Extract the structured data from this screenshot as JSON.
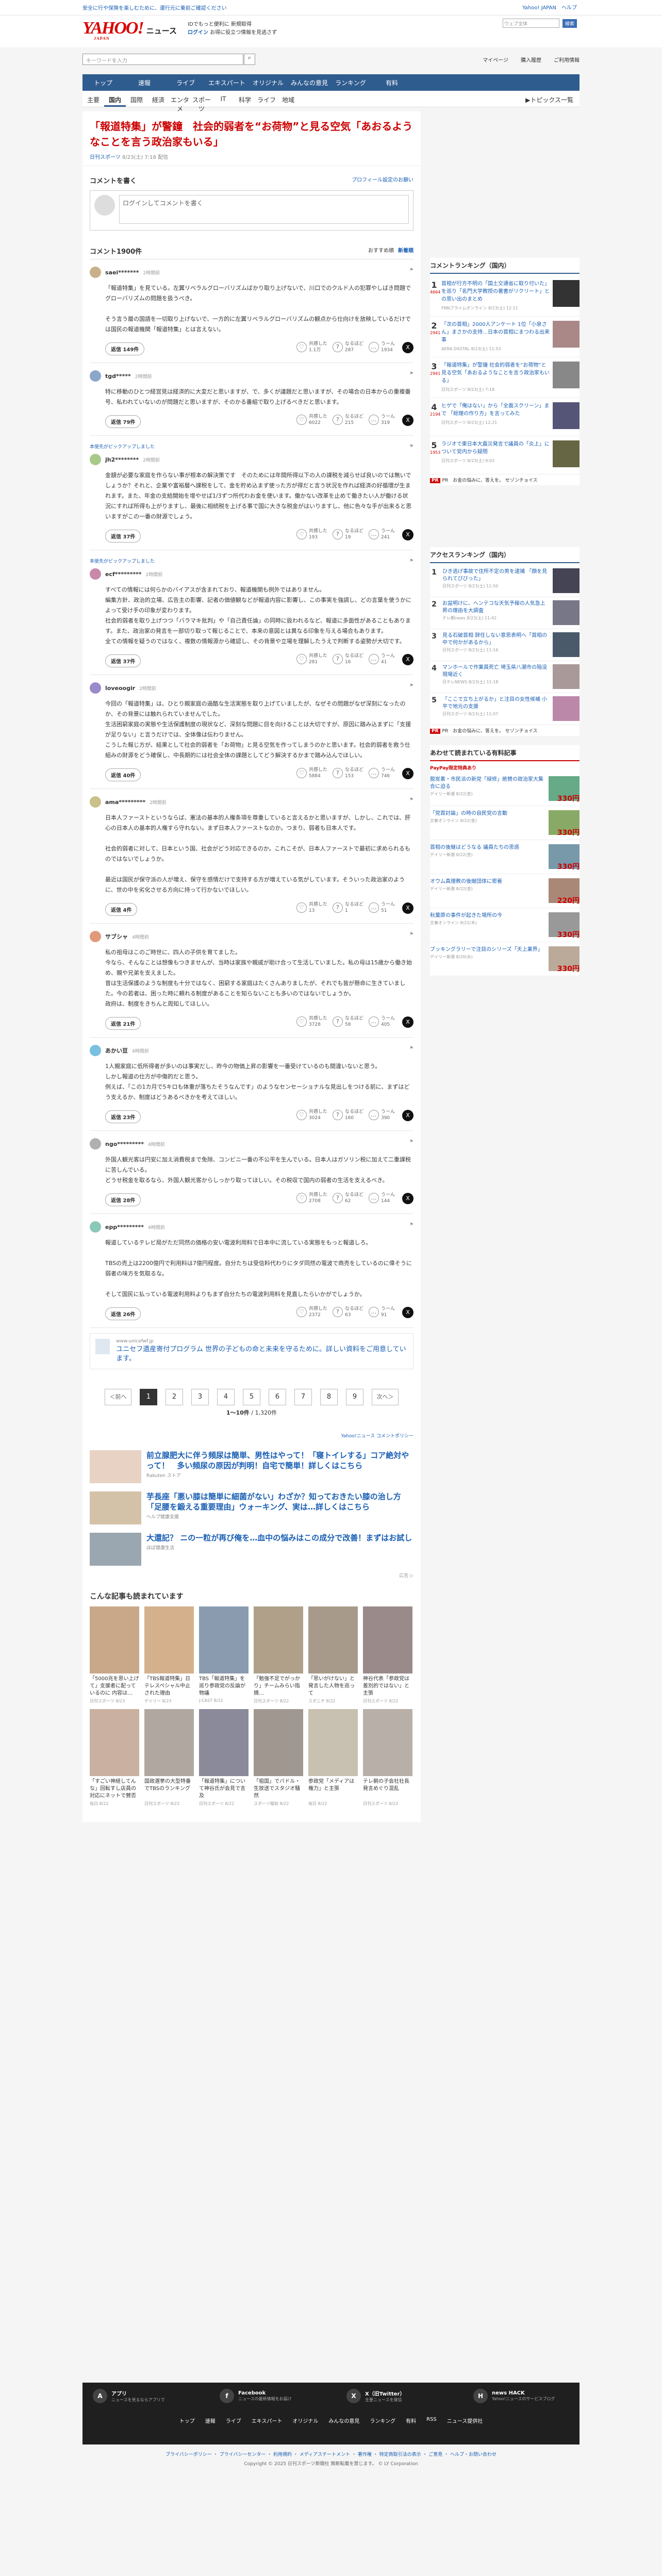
{
  "ticker": {
    "left": "安全に行や保険を楽しむために、運行元に乗前ご確認ください",
    "right": "Yahoo! JAPAN　ヘルプ"
  },
  "header": {
    "logo": "YAHOO!",
    "logo_sub": "ニュース",
    "logo_jp": "JAPAN",
    "line1": "IDでもっと便利に 新規取得",
    "line2_a": "ログイン",
    "line2_b": "お得に役立つ情報を見逃さず",
    "search_ph": "ウェブ全体",
    "search_btn": "検索",
    "search_tab": "▶ 新規取得する"
  },
  "search": {
    "placeholder": "キーワードを入力",
    "links": [
      "マイページ",
      "購入履歴",
      "ご利用情報"
    ]
  },
  "nav1": [
    "トップ",
    "速報",
    "ライブ",
    "エキスパート",
    "オリジナル",
    "みんなの意見",
    "ランキング",
    "有料"
  ],
  "nav2": [
    "主要",
    "国内",
    "国際",
    "経済",
    "エンタメ",
    "スポーツ",
    "IT",
    "科学",
    "ライフ",
    "地域"
  ],
  "nav2_topics": "▶トピックス一覧",
  "article": {
    "title": "「報道特集」が警鐘　社会的弱者を“お荷物”と見る空気「あおるようなことを言う政治家もいる」",
    "source": "日刊スポーツ",
    "time": "8/23(土) 7:18 配信"
  },
  "comment_write": {
    "title": "コメントを書く",
    "profile": "プロフィール設定のお願い",
    "placeholder": "ログインしてコメントを書く"
  },
  "comments_head": {
    "title": "コメント1900件",
    "sort_a": "おすすめ順",
    "sort_b": "新着順"
  },
  "comments": [
    {
      "expert": "",
      "user": "saei*******",
      "time": "2時間前",
      "body": "「報道特集」を見ている。左翼リベラルグローバリズムばかり取り上げないで、川口でのクルド人の犯罪やしばき問題でグローバリズムの問題を扱うべき。\n\nそう言う層の国語を一切取り上げないで、一方的に左翼リベラルグローバリズムの観点から仕向けを放映しているだけでは国民の報道機関「報道特集」とは言えない。",
      "reply": "返信 149件",
      "a": "共感した",
      "ac": "1.1万",
      "b": "なるほど",
      "bc": "287",
      "c": "うーん",
      "cc": "1934"
    },
    {
      "expert": "",
      "user": "tgd*****",
      "time": "2時間前",
      "body": "特に移動のひとつ経営見は経済的に大変だと思いますが、で、多くが議題だと思いますが、その場合の日本からの重複番号、私われていないのが問題だと思いますが、そのかる番組で取り上げるべきだと思います。",
      "reply": "返信 79件",
      "a": "共感した",
      "ac": "6022",
      "b": "なるほど",
      "bc": "215",
      "c": "うーん",
      "cc": "319"
    },
    {
      "expert": "本使先がピックアップしました",
      "user": "jh2********",
      "time": "2時間前",
      "body": "金額が必要な家庭を作らない事が根本の解決策です　そのためには年間所得以下の人の課税を減らせば良いのでは無いでしょうか？それと、企業や富裕層へ課税をして、金を貯め込まず使った方が得だと言う状況を作れば経済の好循環が生まれます。また、年金の支給開始を增やせば1/3ずつ所代わお金を使います。働かない改革を止めて働きたい人が働ける状況にすれば所得も上がりますし、最後に相続税を上げる事で国に大きな税金がはいりますし、他に色々な手が出来ると思いますがこの一番の財源でしょう。",
      "reply": "返信 37件",
      "a": "共感した",
      "ac": "193",
      "b": "なるほど",
      "bc": "19",
      "c": "うーん",
      "cc": "241"
    },
    {
      "expert": "本使先がピックアップしました",
      "user": "ecf*********",
      "time": "2時間前",
      "body": "すべての情報には何らかのバイアスが含まれており、報道機関も例外ではありません。\n編集方針、政治的立場、広告主の影響、記者の価値観などが報道内容に影響し、この事実を強調し、どの言葉を使うかによって受け手の印象が変わります。\n社会的弱者を取り上げつつ「バラマキ批判」や「自己責任論」の同時に扱われるなど、報道に多面性があることもあります。また、政治家の発言を一部切り取って報じることで、本来の意図とは異なる印象を与える場合もあります。\n全ての情報を疑うのではなく、複数の情報源から確認し、その背景や立場を理解したうえで判断する姿勢が大切です。",
      "reply": "返信 37件",
      "a": "共感した",
      "ac": "281",
      "b": "なるほど",
      "bc": "16",
      "c": "うーん",
      "cc": "41"
    },
    {
      "expert": "",
      "user": "loveoogir",
      "time": "2時間前",
      "body": "今回の「報道特集」は、ひとり親家庭の過酷な生活実態を取り上げていましたが、なぜその問題がなぜ深刻になったのか、その背景には触れられていませんでした。\n生活困窮家庭の実態や生活保護制度の現状など、深刻な問題に目を向けることは大切ですが、原因に踏み込まずに「支援が足りない」と言うだけでは、全体像は伝わりません。\nこうした報じ方が、結果として社会的弱者を「お荷物」と見る空気を作ってしまうのかと思います。社会的弱者を救う仕組みの財源をどう確保し、中長期的には社会全体の課題としてどう解決するかまで踏み込んでほしい。",
      "reply": "返信 40件",
      "a": "共感した",
      "ac": "5884",
      "b": "なるほど",
      "bc": "153",
      "c": "うーん",
      "cc": "746"
    },
    {
      "expert": "",
      "user": "ama*********",
      "time": "2時間前",
      "body": "日本人ファーストというならば、憲法の基本的人権条項を尊重していると言えるかと思いますが、しかし、これでは、肝心の日本人の基本的人権すら守れない。まず日本人ファーストなのか。つまり、弱者も日本人です。\n\n社会的弱者に対して、日本という国、社会がどう対応できるのか。これこそが、日本人ファーストで最初に求められるものではないでしょうか。\n\n最近は国民が保守派の人が増え、保守を感情だけで支持する方が増えている気がしています。そういった政治家のように、世の中を劣化させる方向に持って行かないでほしい。",
      "reply": "返信 4件",
      "a": "共感した",
      "ac": "13",
      "b": "なるほど",
      "bc": "1",
      "c": "うーん",
      "cc": "51"
    },
    {
      "expert": "",
      "user": "サブシャ",
      "time": "4時間前",
      "body": "私の祖母はこのご時世に、四人の子供を育てました。\n今なら、そんなことは想像もつきませんが、当時は家族や親戚が助け合って生活していました。私の母は15歳から働き始め、親や兄弟を支えました。\n昔は生活保護のような制度も十分ではなく、困窮する家庭はたくさんありましたが、それでも皆が懸命に生きていました。今の若者は、困った時に頼れる制度があることを知らないことも多いのではないでしょうか。\n政府は、制度をきちんと周知してほしい。",
      "reply": "返信 21件",
      "a": "共感した",
      "ac": "3728",
      "b": "なるほど",
      "bc": "58",
      "c": "うーん",
      "cc": "405"
    },
    {
      "expert": "",
      "user": "あかい豆",
      "time": "4時間前",
      "body": "1人親家庭に低所得者が多いのは事実だし、昨今の物価上昇の影響を一番受けているのも間違いないと思う。\nしかし報道の仕方が中傷的だと思う。\n例えば、「この1カ月で5キロも体重が落ちたそうなんです」のようなセンセーショナルな見出しをつける前に、まずはどう支えるか、制度はどうあるべきかを考えてほしい。",
      "reply": "返信 23件",
      "a": "共感した",
      "ac": "3024",
      "b": "なるほど",
      "bc": "160",
      "c": "うーん",
      "cc": "390"
    },
    {
      "expert": "",
      "user": "ngo*********",
      "time": "4時間前",
      "body": "外国人観光客は円安に加え消費税まで免除、コンビニ一番の不公平を生んでいる。日本人はガソリン税に加えて二重課税に苦しんでいる。\nどうせ税金を取るなら、外国人観光客からしっかり取ってほしい。その税収で国内の弱者の生活を支えるべき。",
      "reply": "返信 28件",
      "a": "共感した",
      "ac": "2708",
      "b": "なるほど",
      "bc": "62",
      "c": "うーん",
      "cc": "144"
    },
    {
      "expert": "",
      "user": "epp*********",
      "time": "4時間前",
      "body": "報道しているテレビ局がただ同然の価格の安い電波利用料で日本中に流している実態をもっと報道しろ。\n\nTBSの売上は2200億円で利用料は7億円程度。自分たちは受信料代わりにタダ同然の電波で商売をしているのに偉そうに弱者の味方を気取るな。\n\nそして国民に払っている電波利用料よりもまず自分たちの電波利用料を見直したらいかがでしょうか。",
      "reply": "返信 26件",
      "a": "共感した",
      "ac": "2372",
      "b": "なるほど",
      "bc": "63",
      "c": "うーん",
      "cc": "91"
    }
  ],
  "inline_ad": {
    "src": "www.unicefwf.jp",
    "title": "ユニセフ遺産寄付プログラム 世界の子どもの命と未来を守るために。詳しい資料をご用意しています。",
    "label": "PR"
  },
  "pager": {
    "prev": "＜前へ",
    "pages": [
      "1",
      "2",
      "3",
      "4",
      "5",
      "6",
      "7",
      "8",
      "9"
    ],
    "next": "次へ＞",
    "count_a": "1〜10件",
    "count_b": "1,320件"
  },
  "policy": "Yahoo!ニュース コメントポリシー",
  "promos": [
    {
      "t": "前立腺肥大に伴う頻尿は簡単、男性はやって！「寝トイレする」コア絶対やって！　多い頻尿の原因が判明！自宅で簡単！詳しくはこちら",
      "s": "Rakuten ストア"
    },
    {
      "t": "芋長座「悪い膝は簡単に細菌がない」わざか？知っておきたい膝の治し方「足腰を鍛える重要理由」ウォーキング、実は…詳しくはこちら",
      "s": "ヘルプ健康支援"
    },
    {
      "t": "大還記？ ニの一粒が再び俺を…血中の悩みはこの成分で改善！まずはお試し",
      "s": "ほぼ健康生活"
    }
  ],
  "adchoice": "広告 ▷",
  "recs_title": "こんな記事も読まれています",
  "recs": [
    {
      "t": "「5000兆を思い上げて」支援者に配っているのに 内容は…",
      "s": "日刊スポーツ 8/23"
    },
    {
      "t": "「TBS報道特集」日テレスペシャル中止された理由",
      "s": "デイリー 8/23"
    },
    {
      "t": "TBS「報道特集」を巡り参政党の反論が物議",
      "s": "J-CAST 8/22"
    },
    {
      "t": "「勉強不足でがっかり」チームみらい指摘…",
      "s": "日刊スポーツ 8/22"
    },
    {
      "t": "「思いがけない」と発言した人物を巡って",
      "s": "スポニチ 8/22"
    },
    {
      "t": "神谷代表「参政党は差別的ではない」と主張",
      "s": "日刊スポーツ 8/22"
    },
    {
      "t": "「すごい神経してんな」回転すし店員の対応にネットで賛否",
      "s": "毎日 8/22"
    },
    {
      "t": "国政選挙の大型特番でTBSのランキング",
      "s": "日刊スポーツ 8/22"
    },
    {
      "t": "「報道特集」について神谷氏が会見で言及",
      "s": "日刊スポーツ 8/22"
    },
    {
      "t": "「祖国」でバドル・生放送でスタジオ騒然",
      "s": "スポーツ報知 8/22"
    },
    {
      "t": "参政党「メディアは権力」と主張",
      "s": "毎日 8/22"
    },
    {
      "t": "テレ朝の子会社社長発言めぐり混乱",
      "s": "日刊スポーツ 8/22"
    }
  ],
  "side_comments": {
    "title": "コメントランキング（国内）",
    "items": [
      {
        "n": "1",
        "m": "4664",
        "t": "首相が行方不明の「国土交通省に取り付いた」を巡り「名門大学教授の著書がリクリート」との思い出のまとめ",
        "s": "FNNプライムオンライン 8/23(土) 12:11"
      },
      {
        "n": "2",
        "m": "2941",
        "t": "「次の首相」2000人アンケート 1位「小泉さん」まさかの支持…日本の首相にまつわる出来事",
        "s": "AERA DIGITAL 8/23(土) 11:53"
      },
      {
        "n": "3",
        "m": "2941",
        "t": "「報道特集」が警鐘 社会的弱者を“お荷物”と見る空気「あおるようなことを言う政治家もいる」",
        "s": "日刊スポーツ 8/23(土) 7:18"
      },
      {
        "n": "4",
        "m": "2194",
        "t": "ヒゲで「俺はない」から「全面スクリーン」まで 「総理の作り方」を言ってみた",
        "s": "日刊スポーツ 8/23(土) 12:21"
      },
      {
        "n": "5",
        "m": "1953",
        "t": "ラジオで東日本大震災発言で議員の「炎上」について党内から疑問",
        "s": "日刊スポーツ 8/23(土) 9:03"
      }
    ],
    "pr": "PR　お金の悩みに、答えを。",
    "pr_s": "セゾンチョイス"
  },
  "side_access": {
    "title": "アクセスランキング（国内）",
    "items": [
      {
        "n": "1",
        "t": "ひき逃げ事故で住所不定の男を逮捕 「顔を見られてびびった」",
        "s": "日刊スポーツ 8/23(土) 11:50"
      },
      {
        "n": "2",
        "t": "お盆明けに、ヘンテコな天気予報の人気急上昇の理由を大調査",
        "s": "テレ朝news 8/23(土) 11:42"
      },
      {
        "n": "3",
        "t": "見る石破首相 辞任しない意思表明へ「首相の中で何かがあるから」",
        "s": "日刊スポーツ 8/23(土) 11:16"
      },
      {
        "n": "4",
        "t": "マンホールで作業員死亡 埼玉県八潮市の陥没現場近く",
        "s": "日テレNEWS 8/23(土) 11:18"
      },
      {
        "n": "5",
        "t": "「ここで立ち上がるか」と注目の女性候補 小平で地元の支援",
        "s": "日刊スポーツ 8/23(土) 11:07"
      }
    ],
    "pr": "PR　お金の悩みに、答えを。",
    "pr_s": "セゾンチョイス"
  },
  "side_paypay": {
    "title": "あわせて読まれている有料記事",
    "badge": "PayPay限定特典あり",
    "items": [
      {
        "t": "脱炭素・市民派の新党「緑修」絶賛の政治家大集合に迫る",
        "s": "デイリー新潮 8/22(金)",
        "p": "330円"
      },
      {
        "t": "「党首討論」の時の自民党の言動",
        "s": "文春オンライン 8/22(金)",
        "p": "330円"
      },
      {
        "t": "首相の後継はどうなる 議員たちの思惑",
        "s": "デイリー新潮 8/22(金)",
        "p": "330円"
      },
      {
        "t": "オウム真理教の後継団体に密着",
        "s": "デイリー新潮 8/22(金)",
        "p": "220円"
      },
      {
        "t": "秋葉原の事件が起きた場所の今",
        "s": "文春オンライン 8/21(木)",
        "p": "330円"
      },
      {
        "t": "ブッキングラリーで注目のシリーズ「天上業界」",
        "s": "デイリー新潮 8/20(水)",
        "p": "330円"
      }
    ]
  },
  "footer": {
    "sns": [
      {
        "i": "A",
        "t": "アプリ",
        "s": "ニュースを見るならアプリで"
      },
      {
        "i": "f",
        "t": "Facebook",
        "s": "ニュースの最新情報をお届け"
      },
      {
        "i": "X",
        "t": "X（旧Twitter）",
        "s": "主要ニュースを発信"
      },
      {
        "i": "H",
        "t": "news HACK",
        "s": "Yahoo!ニュースのサービスブログ"
      }
    ],
    "nav": [
      "トップ",
      "速報",
      "ライブ",
      "エキスパート",
      "オリジナル",
      "みんなの意見",
      "ランキング",
      "有料",
      "RSS",
      "ニュース提供社"
    ],
    "links": "プライバシーポリシー ・ プライバシーセンター ・ 利用規約 ・ メディアステートメント ・ 著作権 ・ 特定商取引法の表示 ・ ご意見 ・ ヘルプ・お問い合わせ",
    "copy": "Copyright © 2025 日刊スポーツ新聞社 無断転載を禁じます。  © LY Corporation"
  }
}
